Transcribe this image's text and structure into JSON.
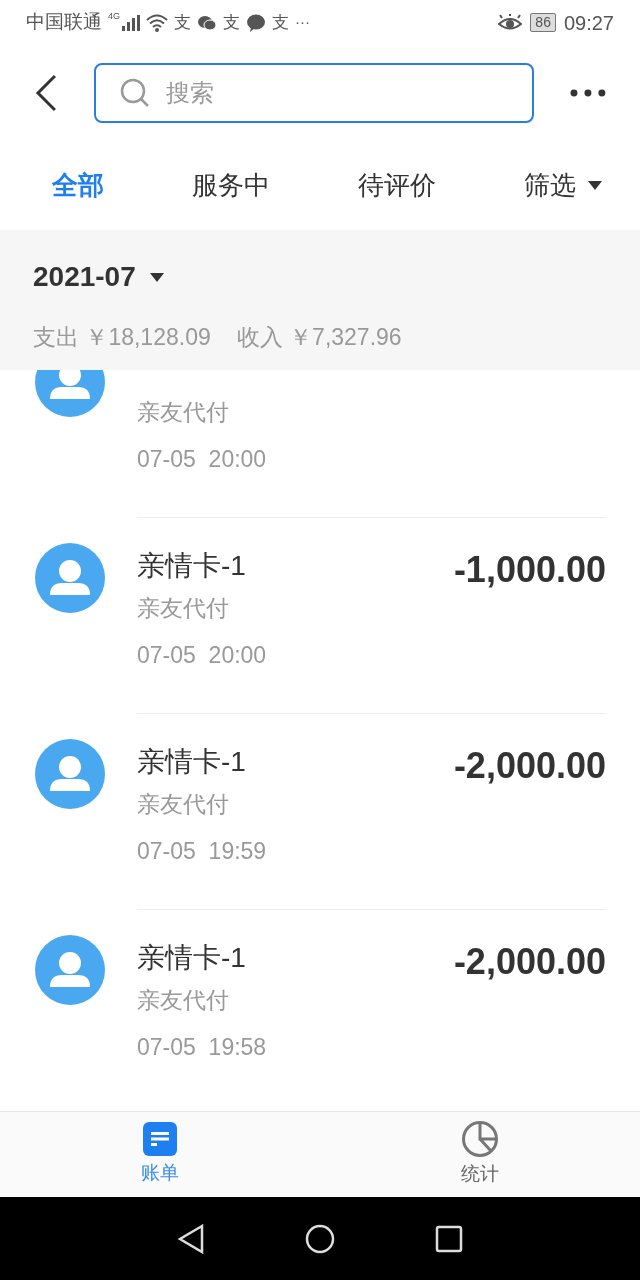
{
  "status_bar": {
    "carrier": "中国联通",
    "network": "4G",
    "notifications": [
      {
        "kind": "alipay",
        "glyph": "支"
      },
      {
        "kind": "wechat"
      },
      {
        "kind": "alipay",
        "glyph": "支"
      },
      {
        "kind": "message"
      },
      {
        "kind": "alipay",
        "glyph": "支"
      }
    ],
    "more": "···",
    "battery": "86",
    "time": "09:27"
  },
  "search": {
    "placeholder": "搜索"
  },
  "tabs": [
    {
      "label": "全部",
      "selected": true,
      "dropdown": false
    },
    {
      "label": "服务中",
      "selected": false,
      "dropdown": false
    },
    {
      "label": "待评价",
      "selected": false,
      "dropdown": false
    },
    {
      "label": "筛选",
      "selected": false,
      "dropdown": true
    }
  ],
  "summary": {
    "month": "2021-07",
    "expense": "支出 ￥18,128.09",
    "income": "收入 ￥7,327.96"
  },
  "transactions": [
    {
      "subtitle": "亲友代付",
      "time": "07-05  20:00"
    },
    {
      "title": "亲情卡-1",
      "subtitle": "亲友代付",
      "time": "07-05  20:00",
      "amount": "-1,000.00"
    },
    {
      "title": "亲情卡-1",
      "subtitle": "亲友代付",
      "time": "07-05  19:59",
      "amount": "-2,000.00"
    },
    {
      "title": "亲情卡-1",
      "subtitle": "亲友代付",
      "time": "07-05  19:58",
      "amount": "-2,000.00"
    }
  ],
  "bottom_nav": [
    {
      "label": "账单",
      "kind": "bill",
      "selected": true
    },
    {
      "label": "统计",
      "kind": "stats",
      "selected": false
    }
  ]
}
